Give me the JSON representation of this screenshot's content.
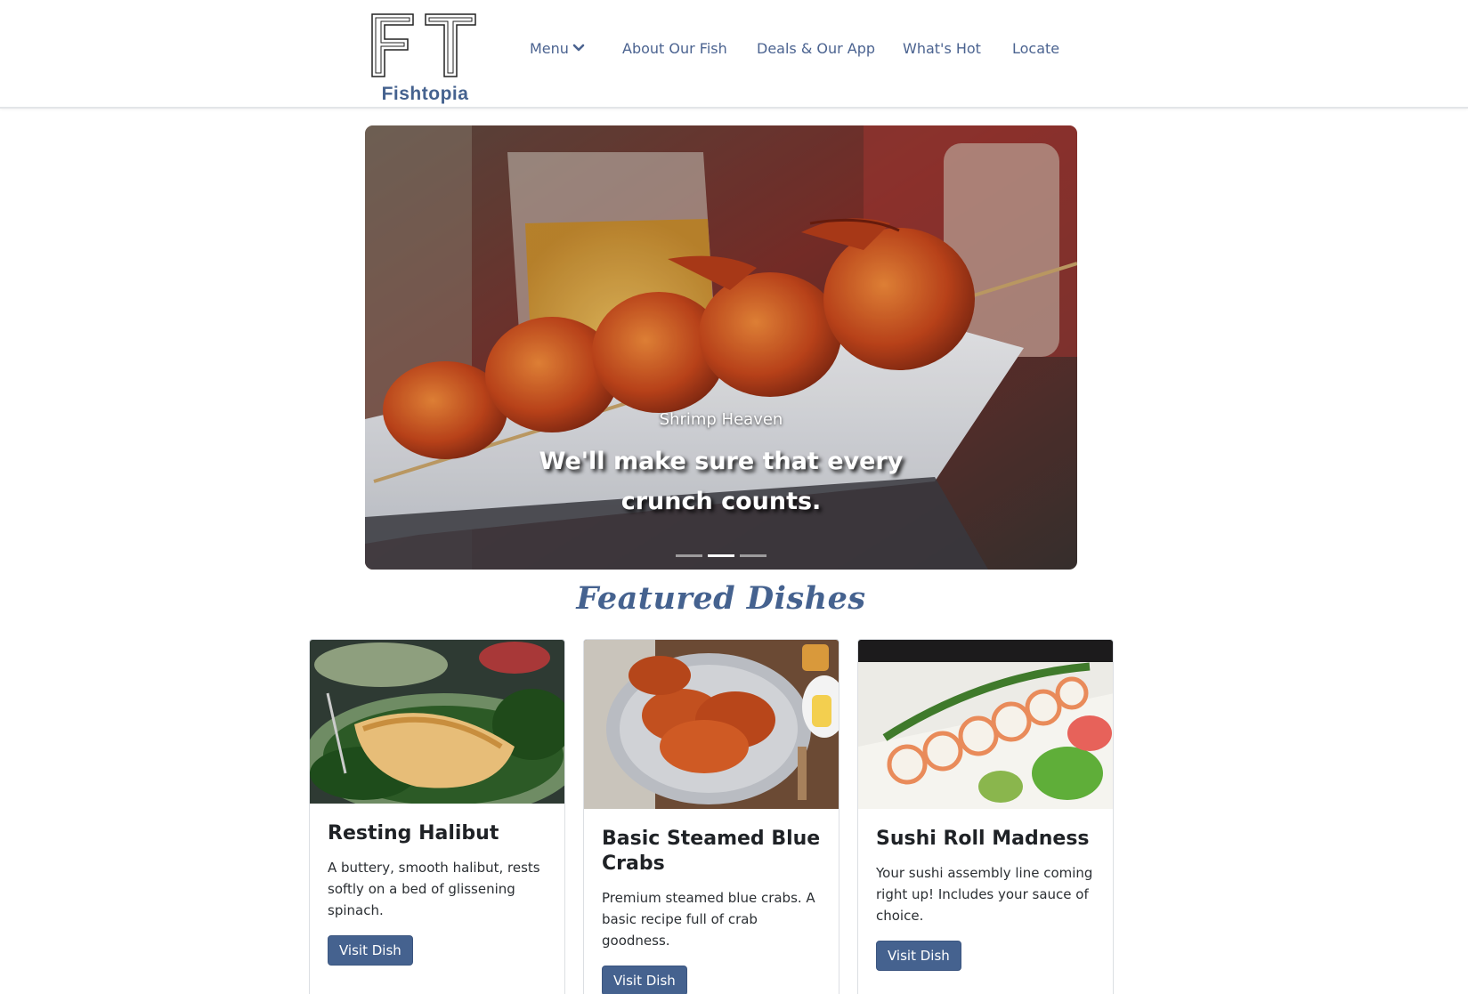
{
  "brand": {
    "name": "Fishtopia"
  },
  "nav": {
    "items": [
      {
        "label": "Menu",
        "has_dropdown": true
      },
      {
        "label": "About Our Fish"
      },
      {
        "label": "Deals & Our App"
      },
      {
        "label": "What's Hot"
      },
      {
        "label": "Locate"
      }
    ]
  },
  "carousel": {
    "slide_title": "Shrimp Heaven",
    "slide_text": "We'll make sure that every crunch counts.",
    "slide_count": 3,
    "active_slide": 2
  },
  "featured": {
    "title": "Featured Dishes",
    "cards": [
      {
        "title": "Resting Halibut",
        "text": "A buttery, smooth halibut, rests softly on a bed of glissening spinach.",
        "button": "Visit Dish"
      },
      {
        "title": "Basic Steamed Blue Crabs",
        "text": "Premium steamed blue crabs. A basic recipe full of crab goodness.",
        "button": "Visit Dish"
      },
      {
        "title": "Sushi Roll Madness",
        "text": "Your sushi assembly line coming right up! Includes your sauce of choice.",
        "button": "Visit Dish"
      }
    ]
  },
  "colors": {
    "brand_blue": "#45628f",
    "nav_text": "#4b6390",
    "button_bg": "#45628f"
  }
}
